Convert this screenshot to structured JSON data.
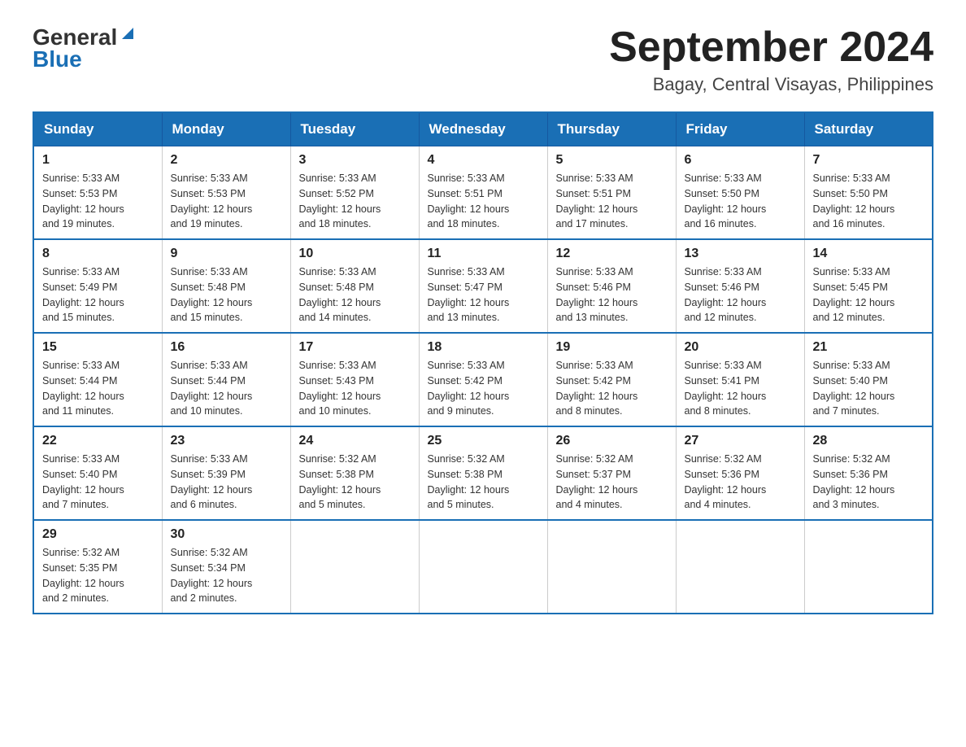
{
  "header": {
    "logo_general": "General",
    "logo_blue": "Blue",
    "title": "September 2024",
    "subtitle": "Bagay, Central Visayas, Philippines"
  },
  "days_of_week": [
    "Sunday",
    "Monday",
    "Tuesday",
    "Wednesday",
    "Thursday",
    "Friday",
    "Saturday"
  ],
  "weeks": [
    [
      {
        "day": "1",
        "sunrise": "5:33 AM",
        "sunset": "5:53 PM",
        "daylight": "12 hours and 19 minutes."
      },
      {
        "day": "2",
        "sunrise": "5:33 AM",
        "sunset": "5:53 PM",
        "daylight": "12 hours and 19 minutes."
      },
      {
        "day": "3",
        "sunrise": "5:33 AM",
        "sunset": "5:52 PM",
        "daylight": "12 hours and 18 minutes."
      },
      {
        "day": "4",
        "sunrise": "5:33 AM",
        "sunset": "5:51 PM",
        "daylight": "12 hours and 18 minutes."
      },
      {
        "day": "5",
        "sunrise": "5:33 AM",
        "sunset": "5:51 PM",
        "daylight": "12 hours and 17 minutes."
      },
      {
        "day": "6",
        "sunrise": "5:33 AM",
        "sunset": "5:50 PM",
        "daylight": "12 hours and 16 minutes."
      },
      {
        "day": "7",
        "sunrise": "5:33 AM",
        "sunset": "5:50 PM",
        "daylight": "12 hours and 16 minutes."
      }
    ],
    [
      {
        "day": "8",
        "sunrise": "5:33 AM",
        "sunset": "5:49 PM",
        "daylight": "12 hours and 15 minutes."
      },
      {
        "day": "9",
        "sunrise": "5:33 AM",
        "sunset": "5:48 PM",
        "daylight": "12 hours and 15 minutes."
      },
      {
        "day": "10",
        "sunrise": "5:33 AM",
        "sunset": "5:48 PM",
        "daylight": "12 hours and 14 minutes."
      },
      {
        "day": "11",
        "sunrise": "5:33 AM",
        "sunset": "5:47 PM",
        "daylight": "12 hours and 13 minutes."
      },
      {
        "day": "12",
        "sunrise": "5:33 AM",
        "sunset": "5:46 PM",
        "daylight": "12 hours and 13 minutes."
      },
      {
        "day": "13",
        "sunrise": "5:33 AM",
        "sunset": "5:46 PM",
        "daylight": "12 hours and 12 minutes."
      },
      {
        "day": "14",
        "sunrise": "5:33 AM",
        "sunset": "5:45 PM",
        "daylight": "12 hours and 12 minutes."
      }
    ],
    [
      {
        "day": "15",
        "sunrise": "5:33 AM",
        "sunset": "5:44 PM",
        "daylight": "12 hours and 11 minutes."
      },
      {
        "day": "16",
        "sunrise": "5:33 AM",
        "sunset": "5:44 PM",
        "daylight": "12 hours and 10 minutes."
      },
      {
        "day": "17",
        "sunrise": "5:33 AM",
        "sunset": "5:43 PM",
        "daylight": "12 hours and 10 minutes."
      },
      {
        "day": "18",
        "sunrise": "5:33 AM",
        "sunset": "5:42 PM",
        "daylight": "12 hours and 9 minutes."
      },
      {
        "day": "19",
        "sunrise": "5:33 AM",
        "sunset": "5:42 PM",
        "daylight": "12 hours and 8 minutes."
      },
      {
        "day": "20",
        "sunrise": "5:33 AM",
        "sunset": "5:41 PM",
        "daylight": "12 hours and 8 minutes."
      },
      {
        "day": "21",
        "sunrise": "5:33 AM",
        "sunset": "5:40 PM",
        "daylight": "12 hours and 7 minutes."
      }
    ],
    [
      {
        "day": "22",
        "sunrise": "5:33 AM",
        "sunset": "5:40 PM",
        "daylight": "12 hours and 7 minutes."
      },
      {
        "day": "23",
        "sunrise": "5:33 AM",
        "sunset": "5:39 PM",
        "daylight": "12 hours and 6 minutes."
      },
      {
        "day": "24",
        "sunrise": "5:32 AM",
        "sunset": "5:38 PM",
        "daylight": "12 hours and 5 minutes."
      },
      {
        "day": "25",
        "sunrise": "5:32 AM",
        "sunset": "5:38 PM",
        "daylight": "12 hours and 5 minutes."
      },
      {
        "day": "26",
        "sunrise": "5:32 AM",
        "sunset": "5:37 PM",
        "daylight": "12 hours and 4 minutes."
      },
      {
        "day": "27",
        "sunrise": "5:32 AM",
        "sunset": "5:36 PM",
        "daylight": "12 hours and 4 minutes."
      },
      {
        "day": "28",
        "sunrise": "5:32 AM",
        "sunset": "5:36 PM",
        "daylight": "12 hours and 3 minutes."
      }
    ],
    [
      {
        "day": "29",
        "sunrise": "5:32 AM",
        "sunset": "5:35 PM",
        "daylight": "12 hours and 2 minutes."
      },
      {
        "day": "30",
        "sunrise": "5:32 AM",
        "sunset": "5:34 PM",
        "daylight": "12 hours and 2 minutes."
      },
      null,
      null,
      null,
      null,
      null
    ]
  ],
  "labels": {
    "sunrise": "Sunrise:",
    "sunset": "Sunset:",
    "daylight": "Daylight:"
  }
}
